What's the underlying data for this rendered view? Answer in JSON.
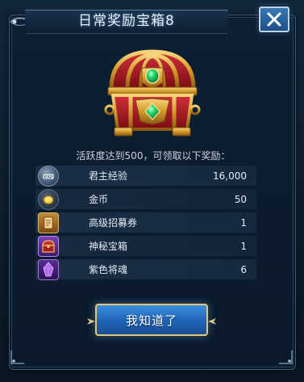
{
  "dialog": {
    "title": "日常奖励宝箱8",
    "subtitle": "活跃度达到500，可领取以下奖励："
  },
  "rewards": [
    {
      "name": "君主经验",
      "qty": "16,000",
      "icon": "lord-exp-icon"
    },
    {
      "name": "金币",
      "qty": "50",
      "icon": "gold-coin-icon"
    },
    {
      "name": "高级招募券",
      "qty": "1",
      "icon": "recruit-ticket-icon"
    },
    {
      "name": "神秘宝箱",
      "qty": "1",
      "icon": "mystery-chest-icon"
    },
    {
      "name": "紫色将魂",
      "qty": "6",
      "icon": "purple-soul-icon"
    }
  ],
  "buttons": {
    "confirm": "我知道了",
    "close_icon": "close-icon"
  },
  "colors": {
    "panel_bg": "#0d1f33",
    "panel_border": "#3b5c7e",
    "button_blue": "#1f62b5",
    "button_gold_border": "#d8c68a",
    "chest_gold": "#d9a93a",
    "chest_red": "#a8131f",
    "gem_green": "#19c25a"
  }
}
